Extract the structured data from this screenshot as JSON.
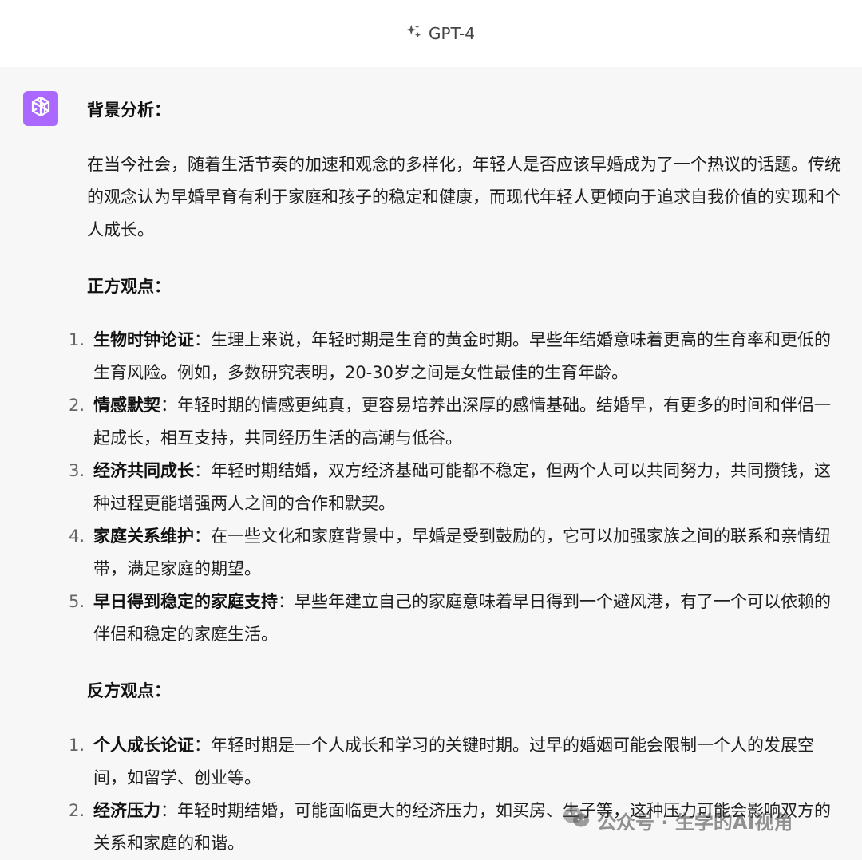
{
  "header": {
    "model_name": "GPT-4",
    "model_icon": "sparkles-icon"
  },
  "avatar": {
    "icon": "openai-logo-icon",
    "color": "#ab68ff"
  },
  "background_section": {
    "heading": "背景分析：",
    "paragraph": "在当今社会，随着生活节奏的加速和观念的多样化，年轻人是否应该早婚成为了一个热议的话题。传统的观念认为早婚早育有利于家庭和孩子的稳定和健康，而现代年轻人更倾向于追求自我价值的实现和个人成长。"
  },
  "pro_section": {
    "heading": "正方观点：",
    "items": [
      {
        "num": "1.",
        "title": "生物时钟论证",
        "sep": "：",
        "text": "生理上来说，年轻时期是生育的黄金时期。早些年结婚意味着更高的生育率和更低的生育风险。例如，多数研究表明，20-30岁之间是女性最佳的生育年龄。"
      },
      {
        "num": "2.",
        "title": "情感默契",
        "sep": "：",
        "text": "年轻时期的情感更纯真，更容易培养出深厚的感情基础。结婚早，有更多的时间和伴侣一起成长，相互支持，共同经历生活的高潮与低谷。"
      },
      {
        "num": "3.",
        "title": "经济共同成长",
        "sep": "：",
        "text": "年轻时期结婚，双方经济基础可能都不稳定，但两个人可以共同努力，共同攒钱，这种过程更能增强两人之间的合作和默契。"
      },
      {
        "num": "4.",
        "title": "家庭关系维护",
        "sep": "：",
        "text": "在一些文化和家庭背景中，早婚是受到鼓励的，它可以加强家族之间的联系和亲情纽带，满足家庭的期望。"
      },
      {
        "num": "5.",
        "title": "早日得到稳定的家庭支持",
        "sep": "：",
        "text": "早些年建立自己的家庭意味着早日得到一个避风港，有了一个可以依赖的伴侣和稳定的家庭生活。"
      }
    ]
  },
  "con_section": {
    "heading": "反方观点：",
    "items": [
      {
        "num": "1.",
        "title": "个人成长论证",
        "sep": "：",
        "text": "年轻时期是一个人成长和学习的关键时期。过早的婚姻可能会限制一个人的发展空间，如留学、创业等。"
      },
      {
        "num": "2.",
        "title": "经济压力",
        "sep": "：",
        "text": "年轻时期结婚，可能面临更大的经济压力，如买房、生子等，这种压力可能会影响双方的关系和家庭的和谐。"
      }
    ]
  },
  "watermark": {
    "icon": "wechat-icon",
    "text": "公众号 · 生学的AI视角"
  }
}
